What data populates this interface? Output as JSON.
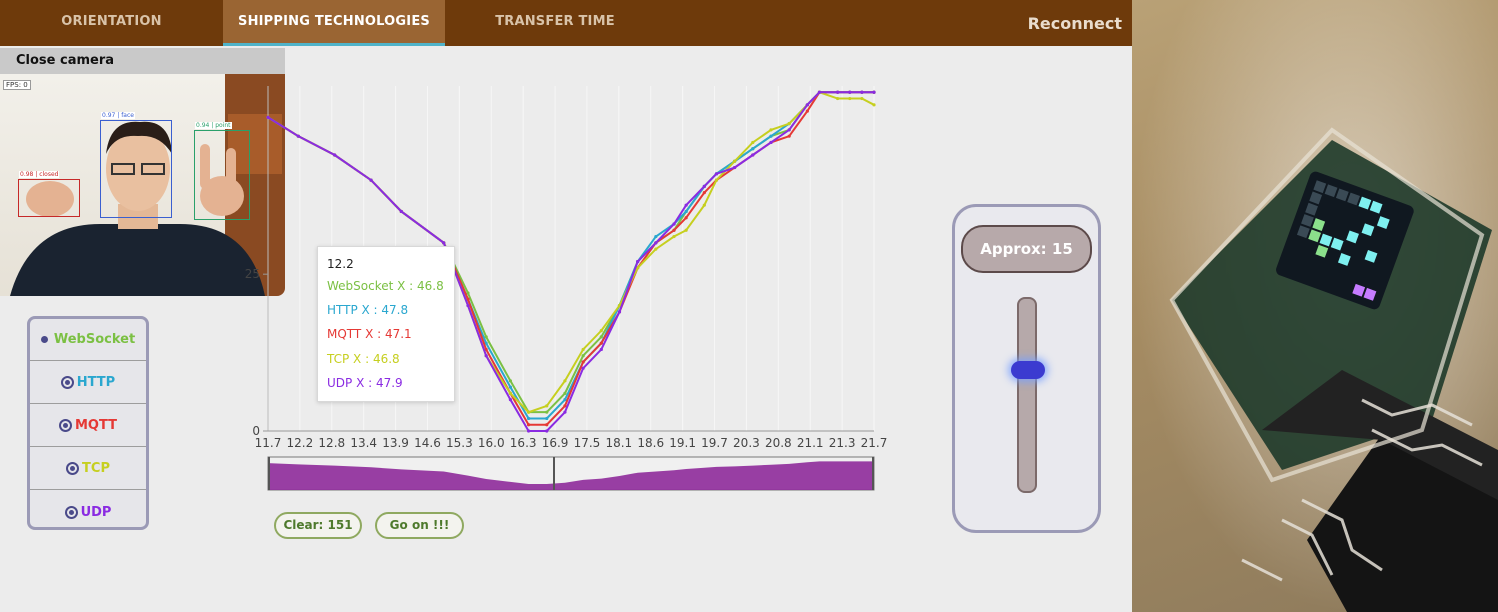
{
  "nav": {
    "tabs": [
      {
        "label": "ORIENTATION"
      },
      {
        "label": "SHIPPING TECHNOLOGIES"
      },
      {
        "label": "TRANSFER TIME"
      }
    ],
    "reconnect_label": "Reconnect"
  },
  "camera": {
    "header_label": "Close camera",
    "fps": "FPS: 0",
    "detections": [
      {
        "label": "0.98 | closed",
        "color": "#c62828"
      },
      {
        "label": "0.97 | face",
        "color": "#3a5fd0"
      },
      {
        "label": "0.94 | point",
        "color": "#2aa06a"
      }
    ]
  },
  "legend": {
    "items": [
      {
        "label": "WebSocket",
        "color": "#7bc043"
      },
      {
        "label": "HTTP",
        "color": "#2aa7cf"
      },
      {
        "label": "MQTT",
        "color": "#e53935"
      },
      {
        "label": "TCP",
        "color": "#c6cf1f"
      },
      {
        "label": "UDP",
        "color": "#8a2be2"
      }
    ]
  },
  "tooltip": {
    "title": "12.2",
    "rows": [
      {
        "text": "WebSocket X : 46.8",
        "color": "#7bc043"
      },
      {
        "text": "HTTP X : 47.8",
        "color": "#2aa7cf"
      },
      {
        "text": "MQTT X : 47.1",
        "color": "#e53935"
      },
      {
        "text": "TCP X : 46.8",
        "color": "#c6cf1f"
      },
      {
        "text": "UDP X : 47.9",
        "color": "#8a2be2"
      }
    ]
  },
  "buttons": {
    "clear_label": "Clear: 151",
    "go_label": "Go on !!!"
  },
  "approx": {
    "label": "Approx: 15",
    "slider_fraction": 0.63
  },
  "chart_data": {
    "type": "line",
    "x_tick_labels": [
      "11.7",
      "12.2",
      "12.8",
      "13.4",
      "13.9",
      "14.6",
      "15.3",
      "16.0",
      "16.3",
      "16.9",
      "17.5",
      "18.1",
      "18.6",
      "19.1",
      "19.7",
      "20.3",
      "20.8",
      "21.1",
      "21.3",
      "21.7"
    ],
    "y_ticks": [
      0,
      25
    ],
    "ylim": [
      0,
      55
    ],
    "x": [
      11.7,
      12.2,
      12.8,
      13.4,
      13.9,
      14.6,
      15.0,
      15.3,
      15.7,
      16.0,
      16.3,
      16.6,
      16.9,
      17.2,
      17.5,
      17.8,
      18.1,
      18.4,
      18.6,
      18.9,
      19.1,
      19.4,
      19.7,
      20.0,
      20.3,
      20.6,
      20.8,
      21.1,
      21.3,
      21.5,
      21.7
    ],
    "series": [
      {
        "name": "WebSocket",
        "color": "#7bc043",
        "values": [
          50,
          47,
          44,
          40,
          35,
          30,
          22,
          15,
          8,
          3,
          3,
          6,
          12,
          15,
          20,
          27,
          30,
          32,
          35,
          39,
          41,
          43,
          45,
          47,
          48,
          52,
          54,
          54,
          54,
          54,
          54
        ]
      },
      {
        "name": "HTTP",
        "color": "#2aa7cf",
        "values": [
          50,
          47,
          44,
          40,
          35,
          30,
          21,
          14,
          7,
          2,
          2,
          5,
          11,
          14,
          20,
          27,
          31,
          33,
          35,
          39,
          41,
          43,
          45,
          47,
          49,
          52,
          54,
          54,
          54,
          54,
          54
        ]
      },
      {
        "name": "MQTT",
        "color": "#e53935",
        "values": [
          50,
          47,
          44,
          40,
          35,
          30,
          21,
          13,
          6,
          1,
          1,
          4,
          11,
          14,
          19,
          26,
          30,
          32,
          34,
          38,
          40,
          42,
          44,
          46,
          47,
          51,
          54,
          54,
          54,
          54,
          54
        ]
      },
      {
        "name": "TCP",
        "color": "#c6cf1f",
        "values": [
          50,
          47,
          44,
          40,
          35,
          30,
          20,
          12,
          6,
          3,
          4,
          8,
          13,
          16,
          20,
          26,
          29,
          31,
          32,
          36,
          40,
          43,
          46,
          48,
          49,
          52,
          54,
          53,
          53,
          53,
          52
        ]
      },
      {
        "name": "UDP",
        "color": "#8a2be2",
        "values": [
          50,
          47,
          44,
          40,
          35,
          30,
          20,
          12,
          5,
          0,
          0,
          3,
          10,
          13,
          19,
          27,
          30,
          33,
          36,
          39,
          41,
          42,
          44,
          46,
          48,
          52,
          54,
          54,
          54,
          54,
          54
        ]
      }
    ]
  }
}
